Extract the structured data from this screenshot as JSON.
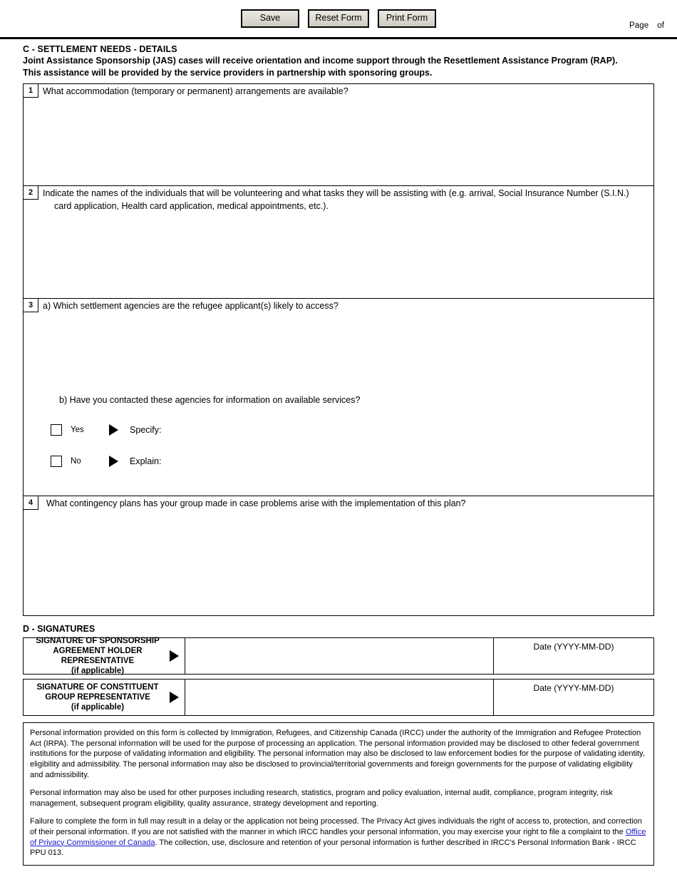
{
  "toolbar": {
    "save_label": "Save",
    "reset_label": "Reset Form",
    "print_label": "Print Form",
    "page_prefix": "Page",
    "page_suffix": "of"
  },
  "section_c": {
    "title": "C - SETTLEMENT NEEDS - DETAILS",
    "intro_line1": "Joint Assistance Sponsorship (JAS) cases will receive orientation and income support through the Resettlement Assistance Program (RAP).",
    "intro_line2": "This assistance will be provided by the service providers in partnership with sponsoring groups.",
    "questions": [
      {
        "number": "1",
        "text": "What accommodation (temporary or permanent) arrangements are available?",
        "value": ""
      },
      {
        "number": "2",
        "text": "Indicate the names of the individuals that will be volunteering and what tasks they will be assisting with (e.g. arrival, Social Insurance Number (S.I.N.)",
        "text_line2": "card application, Health card application, medical appointments, etc.).",
        "value": ""
      },
      {
        "number": "3",
        "text": "a) Which settlement agencies are the refugee applicant(s) likely to access?",
        "sub_b": "b) Have you contacted these agencies for information on available services?",
        "yes_label": "Yes",
        "no_label": "No",
        "specify_label": "Specify:",
        "explain_label": "Explain:",
        "yes_checked": false,
        "no_checked": false,
        "value": "",
        "specify_value": "",
        "explain_value": ""
      },
      {
        "number": "4",
        "text": "What contingency plans has your group made in case problems arise with the implementation of this plan?",
        "value": ""
      }
    ]
  },
  "section_d": {
    "title": "D - SIGNATURES",
    "date_header": "Date (YYYY-MM-DD)",
    "rows": [
      {
        "caption_line1": "SIGNATURE OF SPONSORSHIP",
        "caption_line2": "AGREEMENT HOLDER",
        "caption_line3": "REPRESENTATIVE",
        "caption_line4": "(if applicable)",
        "signature_value": "",
        "date_value": ""
      },
      {
        "caption_line1": "SIGNATURE OF CONSTITUENT",
        "caption_line2": "GROUP REPRESENTATIVE",
        "caption_line3": "(if applicable)",
        "caption_line4": "",
        "signature_value": "",
        "date_value": ""
      }
    ]
  },
  "privacy": {
    "para1": "Personal information provided on this form is collected by Immigration, Refugees, and Citizenship Canada (IRCC) under the authority of the Immigration and Refugee Protection Act (IRPA).  The personal information will be used for the purpose of processing an application.  The personal information provided may be disclosed to other federal government institutions for the purpose of validating information and eligibility.  The personal information may also be disclosed to law enforcement bodies for the purpose of validating identity, eligibility and admissibility.  The personal information may also be disclosed to provincial/territorial governments and foreign governments for the purpose of validating eligibility and admissibility.",
    "para2": "Personal information may also be used for other purposes including research, statistics, program and policy evaluation, internal audit, compliance, program integrity, risk management, subsequent program eligibility, quality assurance, strategy development and reporting.",
    "para3_before": "Failure to complete the form in full may result in a delay or the application not being processed. The Privacy Act gives individuals the right of access to, protection, and correction of their personal information.  If you are not satisfied with the manner in which IRCC handles your personal information, you may exercise your right to file a complaint to the ",
    "para3_link": "Office of Privacy Commissioner of Canada",
    "para3_after": ". The collection, use, disclosure and retention of your personal information is further described in IRCC's Personal Information Bank - IRCC PPU 013."
  },
  "colors": {
    "link": "#1919c8",
    "button_face": "#dedcd3",
    "border": "#000000"
  }
}
